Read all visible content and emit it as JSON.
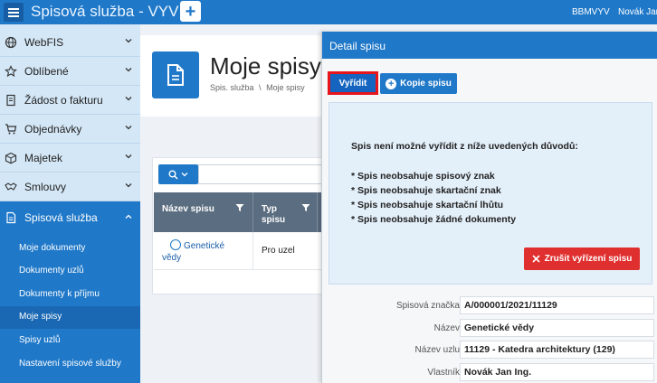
{
  "topbar": {
    "app_title": "Spisová služba - VYV",
    "user_code": "BBMVYV",
    "user_name": "Novák Jan"
  },
  "sidebar": {
    "items": [
      {
        "label": "WebFIS",
        "icon": "globe-icon"
      },
      {
        "label": "Oblíbené",
        "icon": "star-icon"
      },
      {
        "label": "Žádost o fakturu",
        "icon": "invoice-icon"
      },
      {
        "label": "Objednávky",
        "icon": "cart-icon"
      },
      {
        "label": "Majetek",
        "icon": "box-icon"
      },
      {
        "label": "Smlouvy",
        "icon": "handshake-icon"
      },
      {
        "label": "Spisová služba",
        "icon": "document-icon"
      }
    ],
    "subitems": [
      "Moje dokumenty",
      "Dokumenty uzlů",
      "Dokumenty k příjmu",
      "Moje spisy",
      "Spisy uzlů",
      "Nastavení spisové služby"
    ]
  },
  "main": {
    "page_title": "Moje spisy",
    "breadcrumb_1": "Spis. služba",
    "breadcrumb_sep": "\\",
    "breadcrumb_2": "Moje spisy",
    "grid": {
      "col_name": "Název spisu",
      "col_type_1": "Typ",
      "col_type_2": "spisu",
      "row_name": "Genetické vědy",
      "row_type": "Pro uzel"
    }
  },
  "detail": {
    "title": "Detail spisu",
    "btn_resolve": "Vyřídit",
    "btn_copy": "Kopie spisu",
    "message_title": "Spis není možné vyřídit z níže uvedených důvodů:",
    "reasons": [
      "* Spis neobsahuje spisový znak",
      "* Spis neobsahuje skartační znak",
      "* Spis neobsahuje skartační lhůtu",
      "* Spis neobsahuje žádné dokumenty"
    ],
    "btn_cancel_resolve": "Zrušit vyřízení spisu",
    "fields": [
      {
        "label": "Spisová značka",
        "value": "A/000001/2021/11129"
      },
      {
        "label": "Název",
        "value": "Genetické vědy"
      },
      {
        "label": "Název uzlu",
        "value": "11129 - Katedra architektury (129)"
      },
      {
        "label": "Vlastník",
        "value": "Novák Jan Ing."
      }
    ]
  },
  "colors": {
    "primary": "#1f78c8",
    "sidebar_bg": "#d4e7f6",
    "danger": "#e02f2f",
    "highlight": "#e8141c"
  }
}
